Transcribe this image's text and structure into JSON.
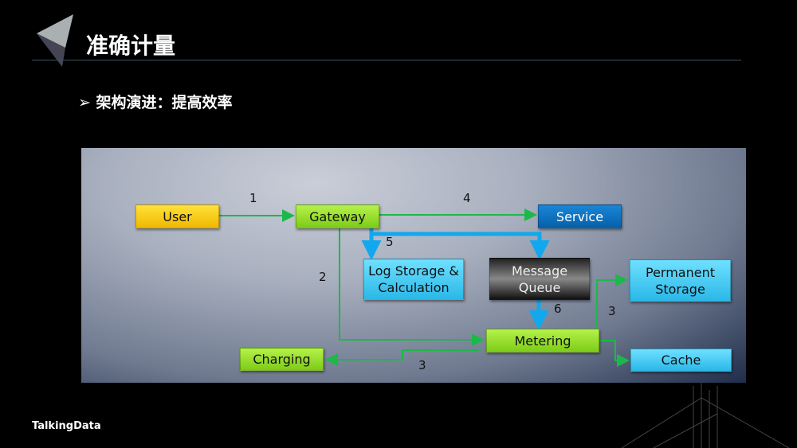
{
  "title": "准确计量",
  "bullet": "架构演进：提高效率",
  "footer": "TalkingData",
  "nodes": {
    "user": "User",
    "gateway": "Gateway",
    "service": "Service",
    "log": "Log Storage & Calculation",
    "mq": "Message Queue",
    "permanent": "Permanent Storage",
    "metering": "Metering",
    "charging": "Charging",
    "cache": "Cache"
  },
  "labels": {
    "e1": "1",
    "e2": "2",
    "e3a": "3",
    "e3b": "3",
    "e4": "4",
    "e5": "5",
    "e6": "6"
  },
  "colors": {
    "flow_green": "#1db84a",
    "flow_blue": "#12a8ee"
  }
}
